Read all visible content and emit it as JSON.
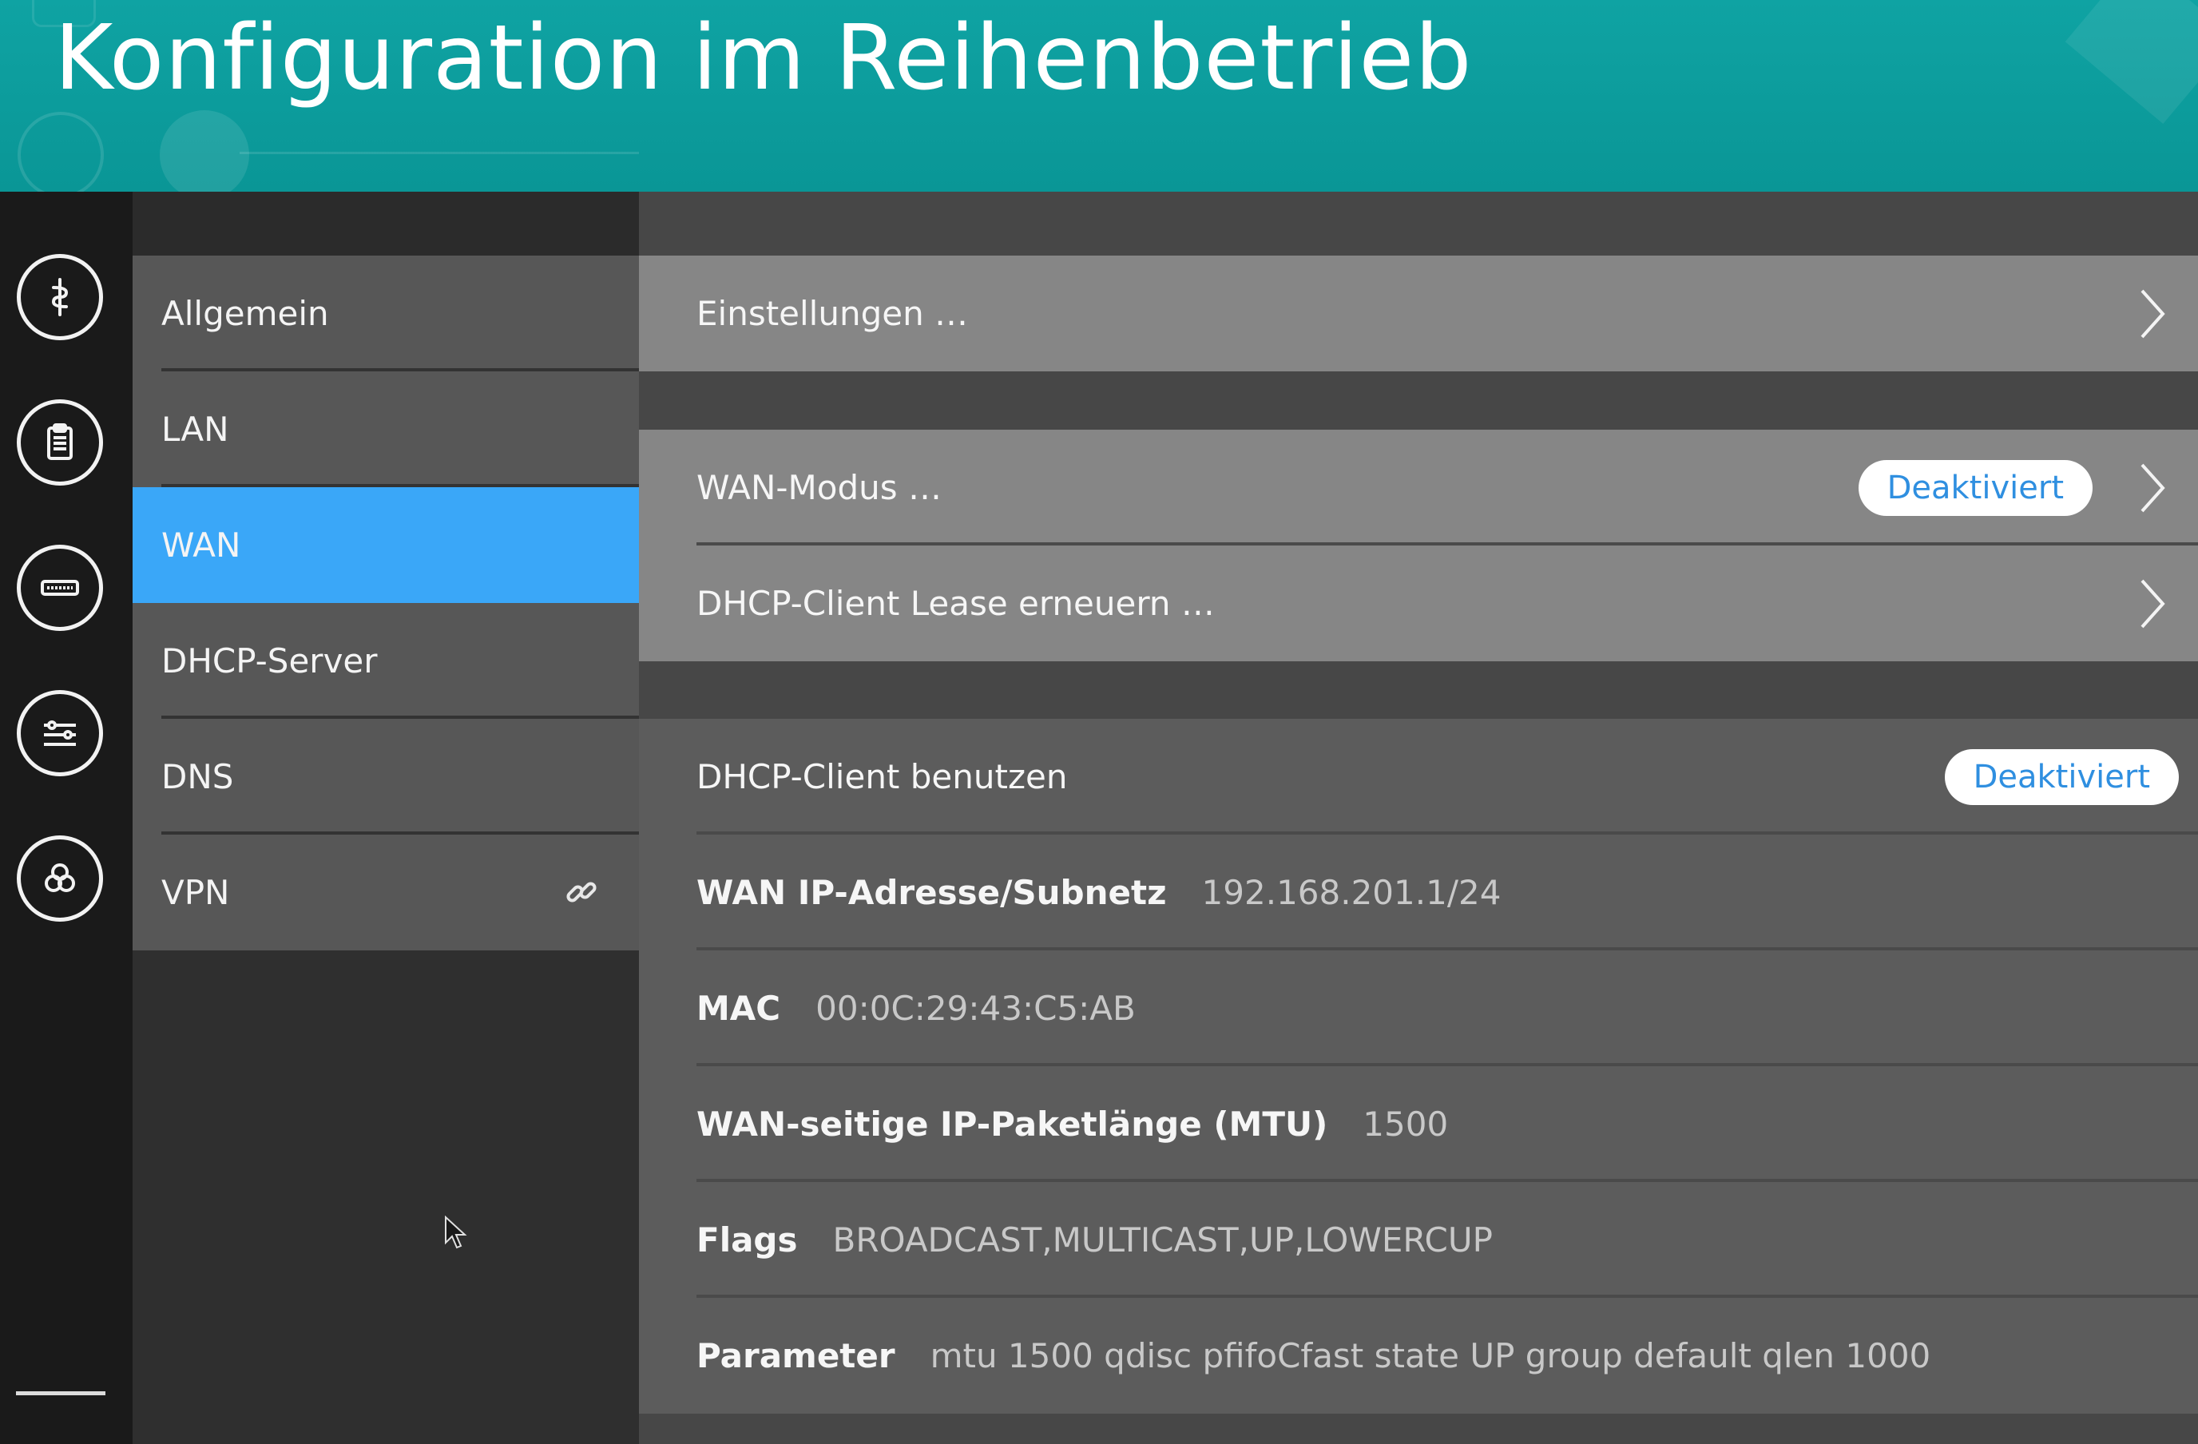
{
  "banner": {
    "title": "Konfiguration im Reihenbetrieb"
  },
  "rail": {
    "icons": [
      "medical-staff-icon",
      "clipboard-icon",
      "switch-device-icon",
      "sliders-icon",
      "network-cluster-icon"
    ]
  },
  "nav": {
    "items": [
      {
        "label": "Allgemein",
        "active": false
      },
      {
        "label": "LAN",
        "active": false
      },
      {
        "label": "WAN",
        "active": true
      },
      {
        "label": "DHCP-Server",
        "active": false
      },
      {
        "label": "DNS",
        "active": false
      },
      {
        "label": "VPN",
        "active": false,
        "icon": "link-icon"
      }
    ]
  },
  "content": {
    "einstellungen": "Einstellungen …",
    "wan_modus": {
      "label": "WAN-Modus …",
      "badge": "Deaktiviert"
    },
    "dhcp_lease": "DHCP-Client Lease erneuern …",
    "dhcp_client": {
      "label": "DHCP-Client benutzen",
      "badge": "Deaktiviert"
    },
    "wan_ip": {
      "label": "WAN IP-Adresse/Subnetz",
      "value": "192.168.201.1/24"
    },
    "mac": {
      "label": "MAC",
      "value": "00:0C:29:43:C5:AB"
    },
    "mtu": {
      "label": "WAN-seitige IP-Paketlänge (MTU)",
      "value": "1500"
    },
    "flags": {
      "label": "Flags",
      "value": "BROADCAST,MULTICAST,UP,LOWERCUP"
    },
    "parameter": {
      "label": "Parameter",
      "value": "mtu 1500 qdisc pfifoCfast state UP group default qlen 1000"
    }
  },
  "colors": {
    "banner": "#0fa3a3",
    "active_nav": "#3aa7f8",
    "badge_text": "#2f8fe0"
  }
}
